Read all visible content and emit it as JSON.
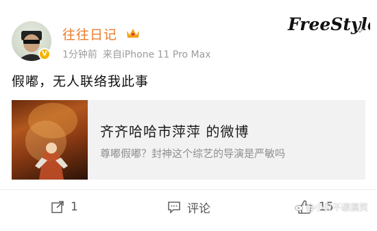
{
  "post": {
    "username": "往往日记",
    "time": "1分钟前",
    "source": "来自iPhone 11 Pro Max",
    "text": "假嘟，无人联络我此事"
  },
  "watermark": {
    "logo_text": "FreeStyle",
    "corner_text": "@小贝不想搞笑"
  },
  "card": {
    "title": "齐齐哈哈市萍萍 的微博",
    "subtitle": "尊嘟假嘟？封神这个综艺的导演是严敏吗"
  },
  "actions": {
    "repost_count": "1",
    "comment_label": "评论",
    "like_count": "15"
  },
  "colors": {
    "username": "#ec7b2a",
    "meta": "#9b9b9b",
    "card_bg": "#f2f2f2",
    "badge": "#f5b400"
  },
  "icons": [
    "verified-badge-icon",
    "crown-icon",
    "chevron-down-icon",
    "repost-icon",
    "comment-icon",
    "like-icon",
    "weibo-logo-icon"
  ]
}
